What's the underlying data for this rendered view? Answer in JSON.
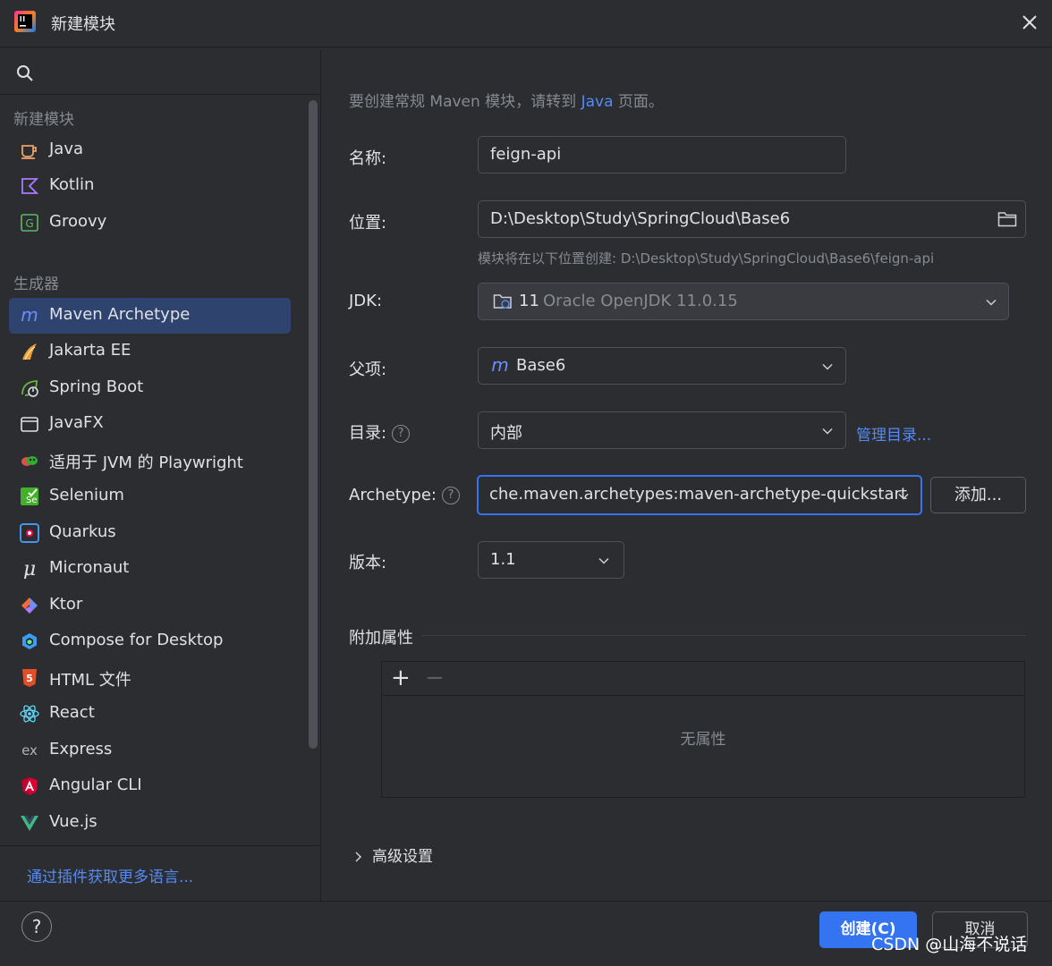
{
  "window": {
    "title": "新建模块"
  },
  "sidebar": {
    "section_new": "新建模块",
    "items_new": [
      {
        "label": "Java",
        "icon": "java-icon"
      },
      {
        "label": "Kotlin",
        "icon": "kotlin-icon"
      },
      {
        "label": "Groovy",
        "icon": "groovy-icon"
      }
    ],
    "section_generators": "生成器",
    "generators": [
      {
        "label": "Maven Archetype",
        "icon": "maven-icon",
        "selected": true
      },
      {
        "label": "Jakarta EE",
        "icon": "jakarta-icon"
      },
      {
        "label": "Spring Boot",
        "icon": "spring-boot-icon"
      },
      {
        "label": "JavaFX",
        "icon": "javafx-icon"
      },
      {
        "label": "适用于 JVM 的 Playwright",
        "icon": "playwright-icon"
      },
      {
        "label": "Selenium",
        "icon": "selenium-icon"
      },
      {
        "label": "Quarkus",
        "icon": "quarkus-icon"
      },
      {
        "label": "Micronaut",
        "icon": "micronaut-icon"
      },
      {
        "label": "Ktor",
        "icon": "ktor-icon"
      },
      {
        "label": "Compose for Desktop",
        "icon": "compose-icon"
      },
      {
        "label": "HTML 文件",
        "icon": "html5-icon"
      },
      {
        "label": "React",
        "icon": "react-icon"
      },
      {
        "label": "Express",
        "icon": "express-icon"
      },
      {
        "label": "Angular CLI",
        "icon": "angular-icon"
      },
      {
        "label": "Vue.js",
        "icon": "vue-icon"
      }
    ],
    "plugin_link": "通过插件获取更多语言..."
  },
  "form": {
    "hint_prefix": "要创建常规 Maven 模块，请转到 ",
    "hint_link": "Java",
    "hint_suffix": " 页面。",
    "name_label": "名称:",
    "name_value": "feign-api",
    "location_label": "位置:",
    "location_value": "D:\\Desktop\\Study\\SpringCloud\\Base6",
    "location_hint": "模块将在以下位置创建: D:\\Desktop\\Study\\SpringCloud\\Base6\\feign-api",
    "jdk_label": "JDK:",
    "jdk_version": "11",
    "jdk_name": "Oracle OpenJDK 11.0.15",
    "parent_label": "父项:",
    "parent_value": "Base6",
    "catalog_label": "目录:",
    "catalog_value": "内部",
    "manage_catalogs": "管理目录...",
    "archetype_label": "Archetype:",
    "archetype_value": "che.maven.archetypes:maven-archetype-quickstart",
    "add_button": "添加...",
    "version_label": "版本:",
    "version_value": "1.1",
    "additional_props": "附加属性",
    "props_add": "+",
    "props_remove": "−",
    "no_props": "无属性",
    "advanced": "高级设置"
  },
  "footer": {
    "help": "?",
    "create": "创建(C)",
    "cancel": "取消"
  },
  "watermark": "CSDN @山海不说话",
  "colors": {
    "accent": "#3574f0",
    "link": "#548af7",
    "selected": "#2e436e",
    "background": "#2b2d30"
  }
}
